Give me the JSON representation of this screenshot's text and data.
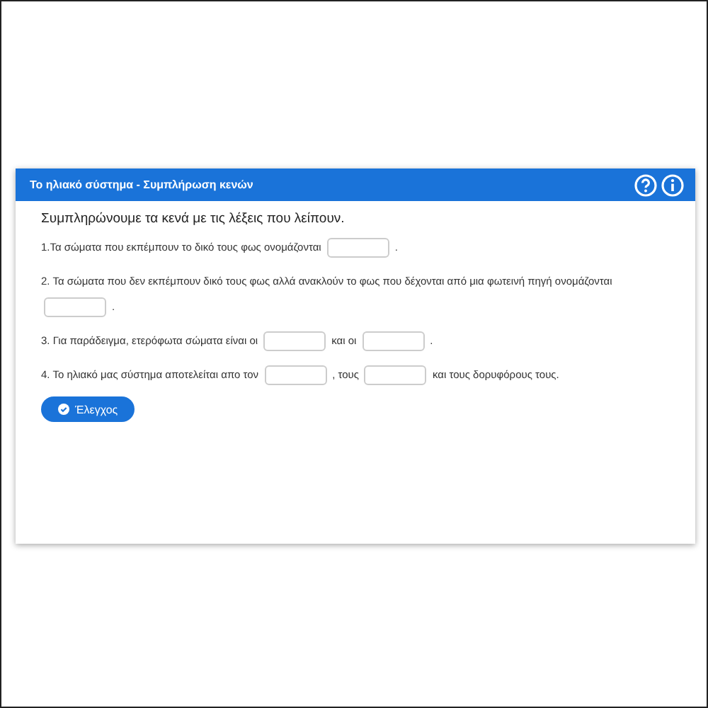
{
  "panel": {
    "title": "Το ηλιακό σύστημα - Συμπλήρωση κενών"
  },
  "instruction": "Συμπληρώνουμε τα κενά με τις λέξεις που λείπουν.",
  "sentences": [
    {
      "parts": [
        {
          "kind": "text",
          "text": "1.Τα σώματα που εκπέμπουν το δικό τους φως ονομάζονται"
        },
        {
          "kind": "blank"
        },
        {
          "kind": "text",
          "text": "."
        }
      ]
    },
    {
      "parts": [
        {
          "kind": "text",
          "text": "2. Τα σώματα που δεν εκπέμπουν δικό τους φως αλλά ανακλούν το φως που δέχονται από μια φωτεινή πηγή ονομάζονται"
        },
        {
          "kind": "blank"
        },
        {
          "kind": "text",
          "text": "."
        }
      ]
    },
    {
      "parts": [
        {
          "kind": "text",
          "text": "3. Για παράδειγμα, ετερόφωτα σώματα είναι οι"
        },
        {
          "kind": "blank"
        },
        {
          "kind": "text",
          "text": "και οι"
        },
        {
          "kind": "blank"
        },
        {
          "kind": "text",
          "text": "."
        }
      ]
    },
    {
      "parts": [
        {
          "kind": "text",
          "text": "4. Το ηλιακό μας σύστημα αποτελείται απο τον"
        },
        {
          "kind": "blank"
        },
        {
          "kind": "text",
          "text": ", τους"
        },
        {
          "kind": "blank"
        },
        {
          "kind": "text",
          "text": "και τους δορυφόρους τους."
        }
      ]
    }
  ],
  "check_button": {
    "label": "Έλεγχος"
  }
}
